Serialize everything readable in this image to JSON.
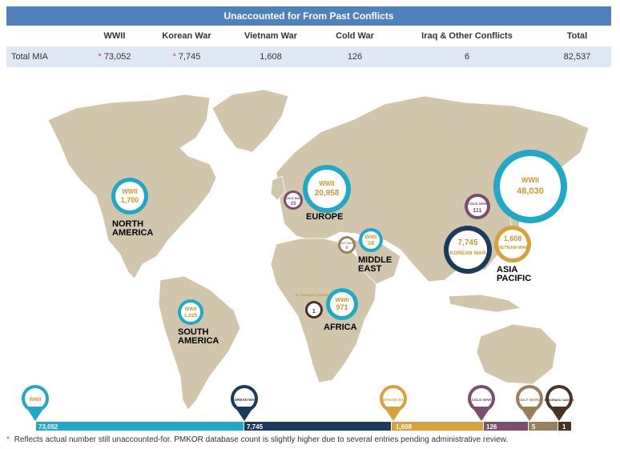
{
  "table": {
    "title": "Unaccounted for From Past Conflicts",
    "headers": [
      "",
      "WWII",
      "Korean War",
      "Vietnam War",
      "Cold War",
      "Iraq & Other Conflicts",
      "Total"
    ],
    "row_label": "Total MIA",
    "values": [
      "73,052",
      "7,745",
      "1,608",
      "126",
      "6",
      "82,537"
    ],
    "marker": "*"
  },
  "regions": {
    "north_america": {
      "name1": "NORTH",
      "name2": "AMERICA",
      "conflict": "WWII",
      "value": "1,700"
    },
    "south_america": {
      "name1": "SOUTH",
      "name2": "AMERICA",
      "conflict": "WWII",
      "value": "1,025"
    },
    "europe": {
      "name": "EUROPE",
      "conflict": "WWII",
      "value": "20,958",
      "cold_conflict": "COLD WAR",
      "cold_value": "15"
    },
    "middle_east": {
      "name1": "MIDDLE",
      "name2": "EAST",
      "conflict": "WWII",
      "value": "19",
      "gulf_conflict": "GULF WARS",
      "gulf_value": "6"
    },
    "africa": {
      "name": "AFRICA",
      "conflict": "WWII",
      "value": "971",
      "eldorado_conflict": "EL DORADO CANYON",
      "eldorado_value": "1"
    },
    "asia_pacific": {
      "name1": "ASIA",
      "name2": "PACIFIC",
      "conflict": "WWII",
      "value": "48,030",
      "korean_conflict": "KOREAN WAR",
      "korean_value": "7,745",
      "vietnam_conflict": "VIETNAM WAR",
      "vietnam_value": "1,608",
      "cold_conflict": "COLD WAR",
      "cold_value": "111"
    }
  },
  "bar": {
    "segments": [
      {
        "label": "WWII",
        "value": "73,052",
        "color": "#1fa8c7"
      },
      {
        "label": "KOREAN WAR",
        "value": "7,745",
        "color": "#1b3a5c"
      },
      {
        "label": "VIETNAM WAR",
        "value": "1,608",
        "color": "#d9a13a"
      },
      {
        "label": "COLD WAR",
        "value": "126",
        "color": "#7b4e6d"
      },
      {
        "label": "GULF WARS",
        "value": "5",
        "color": "#9a7f5c"
      },
      {
        "label": "EL DORADO CANYON",
        "value": "1",
        "color": "#4a3326"
      }
    ]
  },
  "footnote": {
    "marker": "*",
    "text": "Reflects actual number still unaccounted-for. PMKOR database count is slightly higher due to several entries pending administrative review."
  },
  "colors": {
    "header": "#4f81bd",
    "land": "#d1c6ab",
    "wwii": "#1fa8c7",
    "korean": "#1b3a5c",
    "vietnam": "#d9a13a",
    "cold": "#7b4e6d",
    "gulf": "#9a7f5c",
    "eldorado": "#4a3326",
    "star": "#e33592"
  }
}
